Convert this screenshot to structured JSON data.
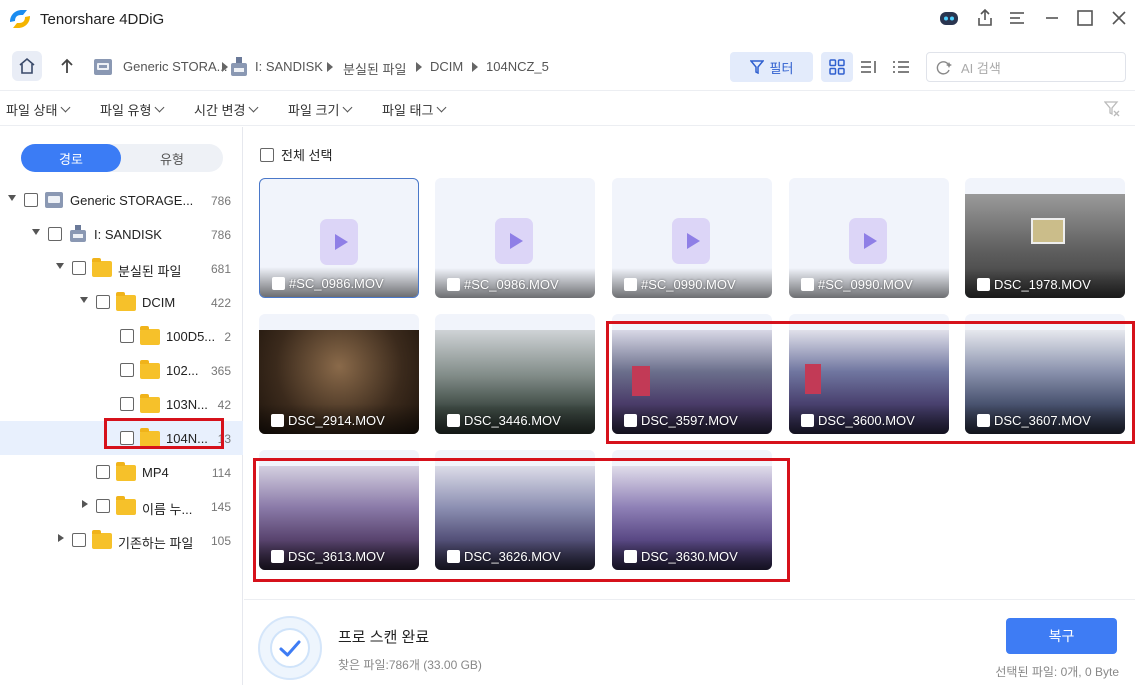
{
  "app": {
    "title": "Tenorshare 4DDiG"
  },
  "breadcrumb": [
    "Generic STORA...",
    "I: SANDISK",
    "분실된 파일",
    "DCIM",
    "104NCZ_5"
  ],
  "toolbar": {
    "filter_label": "필터"
  },
  "search": {
    "placeholder": "AI 검색",
    "value": ""
  },
  "filters": [
    "파일 상태",
    "파일 유형",
    "시간 변경",
    "파일 크기",
    "파일 태그"
  ],
  "sidebar": {
    "tabs": {
      "path": "경로",
      "type": "유형"
    },
    "tree": [
      {
        "label": "Generic STORAGE...",
        "count": "786"
      },
      {
        "label": "I: SANDISK",
        "count": "786"
      },
      {
        "label": "분실된 파일",
        "count": "681"
      },
      {
        "label": "DCIM",
        "count": "422"
      },
      {
        "label": "100D5...",
        "count": "2"
      },
      {
        "label": "102...",
        "count": "365"
      },
      {
        "label": "103N...",
        "count": "42"
      },
      {
        "label": "104N...",
        "count": "13"
      },
      {
        "label": "MP4",
        "count": "114"
      },
      {
        "label": "이름 누...",
        "count": "145"
      },
      {
        "label": "기존하는 파일",
        "count": "105"
      }
    ]
  },
  "main": {
    "select_all_label": "전체 선택",
    "files": [
      {
        "name": "#SC_0986.MOV"
      },
      {
        "name": "#SC_0986.MOV"
      },
      {
        "name": "#SC_0990.MOV"
      },
      {
        "name": "#SC_0990.MOV"
      },
      {
        "name": "DSC_1978.MOV"
      },
      {
        "name": "DSC_2914.MOV"
      },
      {
        "name": "DSC_3446.MOV"
      },
      {
        "name": "DSC_3597.MOV"
      },
      {
        "name": "DSC_3600.MOV"
      },
      {
        "name": "DSC_3607.MOV"
      },
      {
        "name": "DSC_3613.MOV"
      },
      {
        "name": "DSC_3626.MOV"
      },
      {
        "name": "DSC_3630.MOV"
      }
    ]
  },
  "footer": {
    "status_title": "프로 스캔 완료",
    "found_files": "찾은 파일:786개 (33.00 GB)",
    "recover_label": "복구",
    "selected_info": "선택된 파일: 0개, 0 Byte"
  },
  "colors": {
    "accent": "#3e7cf4",
    "highlight": "#d6111b",
    "folder": "#f6c12a"
  }
}
